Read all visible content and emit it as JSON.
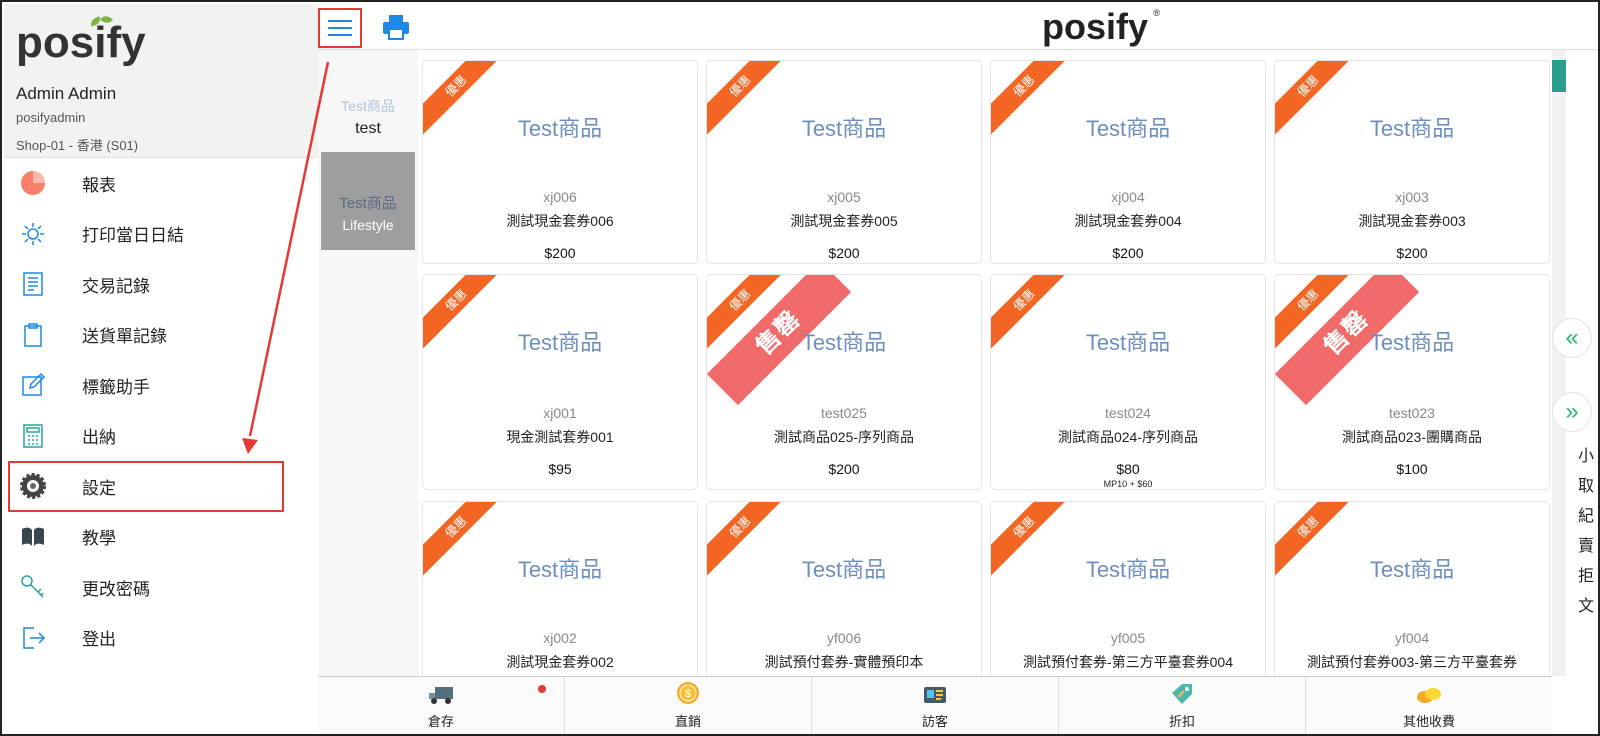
{
  "sidebar": {
    "logo": "posify",
    "user_name": "Admin Admin",
    "user_id": "posifyadmin",
    "shop": "Shop-01 - 香港 (S01)",
    "items": [
      {
        "label": "報表",
        "icon": "report-pie-icon"
      },
      {
        "label": "打印當日日結",
        "icon": "sun-icon"
      },
      {
        "label": "交易記錄",
        "icon": "ledger-icon"
      },
      {
        "label": "送貨單記錄",
        "icon": "clipboard-icon"
      },
      {
        "label": "標籤助手",
        "icon": "edit-icon"
      },
      {
        "label": "出納",
        "icon": "calculator-icon"
      },
      {
        "label": "設定",
        "icon": "gear-icon"
      },
      {
        "label": "教學",
        "icon": "book-icon"
      },
      {
        "label": "更改密碼",
        "icon": "key-icon"
      },
      {
        "label": "登出",
        "icon": "logout-icon"
      }
    ]
  },
  "header": {
    "logo": "posify",
    "registered": "®"
  },
  "categories": [
    {
      "image_text": "Test商品",
      "name": "test"
    },
    {
      "image_text": "Test商品",
      "name": "Lifestyle"
    }
  ],
  "products": [
    {
      "image_text": "Test商品",
      "code": "xj006",
      "name": "測試現金套券006",
      "price": "$200",
      "promo": "優惠"
    },
    {
      "image_text": "Test商品",
      "code": "xj005",
      "name": "測試現金套券005",
      "price": "$200",
      "promo": "優惠"
    },
    {
      "image_text": "Test商品",
      "code": "xj004",
      "name": "測試現金套券004",
      "price": "$200",
      "promo": "優惠"
    },
    {
      "image_text": "Test商品",
      "code": "xj003",
      "name": "測試現金套券003",
      "price": "$200",
      "promo": "優惠"
    },
    {
      "image_text": "Test商品",
      "code": "xj001",
      "name": "現金測試套券001",
      "price": "$95",
      "promo": "優惠"
    },
    {
      "image_text": "Test商品",
      "code": "test025",
      "name": "測試商品025-序列商品",
      "price": "$200",
      "promo": "優惠",
      "soldout": "售罄"
    },
    {
      "image_text": "Test商品",
      "code": "test024",
      "name": "測試商品024-序列商品",
      "price": "$80",
      "promo": "優惠",
      "sub_price": "MP10 + $60"
    },
    {
      "image_text": "Test商品",
      "code": "test023",
      "name": "測試商品023-團購商品",
      "price": "$100",
      "promo": "優惠",
      "soldout": "售罄"
    },
    {
      "image_text": "Test商品",
      "code": "xj002",
      "name": "測試現金套券002",
      "price": "",
      "promo": "優惠"
    },
    {
      "image_text": "Test商品",
      "code": "yf006",
      "name": "測試預付套券-實體預印本",
      "price": "",
      "promo": "優惠"
    },
    {
      "image_text": "Test商品",
      "code": "yf005",
      "name": "測試預付套券-第三方平臺套券004",
      "price": "",
      "promo": "優惠"
    },
    {
      "image_text": "Test商品",
      "code": "yf004",
      "name": "測試預付套券003-第三方平臺套券",
      "price": "",
      "promo": "優惠"
    }
  ],
  "side_text": [
    "小",
    "取",
    "紀",
    "賣",
    "拒",
    "文"
  ],
  "bottom_tabs": [
    {
      "label": "倉存",
      "icon": "truck-icon",
      "badge": true
    },
    {
      "label": "直銷",
      "icon": "coin-icon"
    },
    {
      "label": "訪客",
      "icon": "id-card-icon"
    },
    {
      "label": "折扣",
      "icon": "tag-icon"
    },
    {
      "label": "其他收費",
      "icon": "coins-icon"
    }
  ],
  "nav": {
    "prev": "«",
    "next": "»"
  },
  "colors": {
    "promo": "#f26522",
    "soldout": "#f06a6a",
    "accent": "#1e88e5",
    "highlight": "#e53935",
    "nav": "#2bb673"
  }
}
